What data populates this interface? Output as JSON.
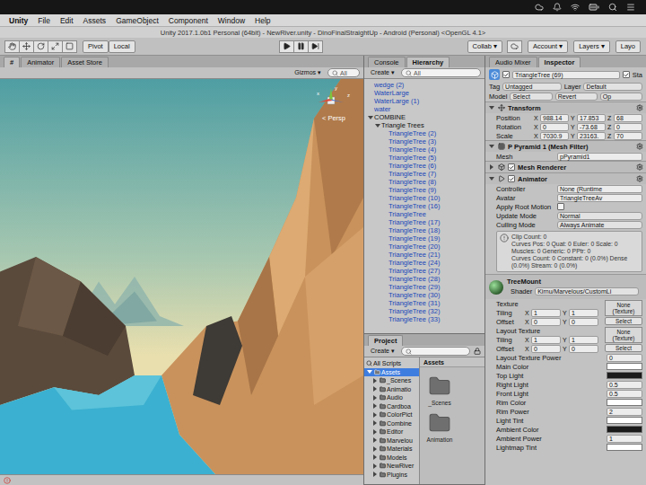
{
  "menu": [
    "Unity",
    "File",
    "Edit",
    "Assets",
    "GameObject",
    "Component",
    "Window",
    "Help"
  ],
  "title": "Unity 2017.1.0b1 Personal (64bit) - NewRiver.unity - DinoFinalStraightUp - Android (Personal) <OpenGL 4.1>",
  "toolbar": {
    "pivot": "Pivot",
    "local": "Local",
    "collab": "Collab ▾",
    "account": "Account ▾",
    "layers": "Layers ▾",
    "layout": "Layo"
  },
  "scene": {
    "tabs": [
      {
        "label": "#",
        "selected": true
      },
      {
        "label": "Animator",
        "selected": false
      },
      {
        "label": "Asset Store",
        "selected": false
      }
    ],
    "gizmos": "Gizmos ▾",
    "search": "All",
    "persp": "< Persp",
    "axes": [
      {
        "label": "y",
        "color": "#7ec53b"
      },
      {
        "label": "x",
        "color": "#e0483a"
      },
      {
        "label": "z",
        "color": "#3a6ee0"
      }
    ]
  },
  "hierarchy": {
    "tabs": [
      {
        "label": "Console",
        "selected": false
      },
      {
        "label": "Hierarchy",
        "selected": true
      }
    ],
    "create": "Create ▾",
    "search": "All",
    "items": [
      {
        "label": "wedge (2)",
        "kind": "prefab",
        "selected": false
      },
      {
        "label": "WaterLarge",
        "kind": "prefab",
        "selected": false
      },
      {
        "label": "WaterLarge (1)",
        "kind": "prefab",
        "selected": false
      },
      {
        "label": "water",
        "kind": "prefab",
        "selected": false
      },
      {
        "label": "COMBINE",
        "kind": "object",
        "selected": false,
        "expanded": true,
        "children": [
          {
            "label": "Triangle Trees",
            "kind": "object",
            "selected": false,
            "expanded": true,
            "children": [
              {
                "label": "TriangleTree (2)",
                "kind": "prefab",
                "selected": false
              },
              {
                "label": "TriangleTree (3)",
                "kind": "prefab",
                "selected": false
              },
              {
                "label": "TriangleTree (4)",
                "kind": "prefab",
                "selected": false
              },
              {
                "label": "TriangleTree (5)",
                "kind": "prefab",
                "selected": false
              },
              {
                "label": "TriangleTree (6)",
                "kind": "prefab",
                "selected": false
              },
              {
                "label": "TriangleTree (7)",
                "kind": "prefab",
                "selected": false
              },
              {
                "label": "TriangleTree (8)",
                "kind": "prefab",
                "selected": false
              },
              {
                "label": "TriangleTree (9)",
                "kind": "prefab",
                "selected": false
              },
              {
                "label": "TriangleTree (10)",
                "kind": "prefab",
                "selected": false
              },
              {
                "label": "TriangleTree (16)",
                "kind": "prefab",
                "selected": false
              },
              {
                "label": "TriangleTree",
                "kind": "prefab",
                "selected": false
              },
              {
                "label": "TriangleTree (17)",
                "kind": "prefab",
                "selected": false
              },
              {
                "label": "TriangleTree (18)",
                "kind": "prefab",
                "selected": false
              },
              {
                "label": "TriangleTree (19)",
                "kind": "prefab",
                "selected": false
              },
              {
                "label": "TriangleTree (20)",
                "kind": "prefab",
                "selected": false
              },
              {
                "label": "TriangleTree (21)",
                "kind": "prefab",
                "selected": false
              },
              {
                "label": "TriangleTree (24)",
                "kind": "prefab",
                "selected": false
              },
              {
                "label": "TriangleTree (27)",
                "kind": "prefab",
                "selected": false
              },
              {
                "label": "TriangleTree (28)",
                "kind": "prefab",
                "selected": false
              },
              {
                "label": "TriangleTree (29)",
                "kind": "prefab",
                "selected": false
              },
              {
                "label": "TriangleTree (30)",
                "kind": "prefab",
                "selected": false
              },
              {
                "label": "TriangleTree (31)",
                "kind": "prefab",
                "selected": false
              },
              {
                "label": "TriangleTree (32)",
                "kind": "prefab",
                "selected": false
              },
              {
                "label": "TriangleTree (33)",
                "kind": "prefab",
                "selected": false
              }
            ]
          }
        ]
      }
    ]
  },
  "project": {
    "tabs": [
      {
        "label": "Project",
        "selected": true
      }
    ],
    "create": "Create ▾",
    "favorites": [
      "All Scripts"
    ],
    "root": {
      "label": "Assets",
      "expanded": true,
      "selected": true,
      "children": [
        {
          "label": "_Scenes",
          "expanded": false,
          "selected": false
        },
        {
          "label": "Animatio",
          "expanded": false,
          "selected": false
        },
        {
          "label": "Audio",
          "expanded": false,
          "selected": false
        },
        {
          "label": "Cardboa",
          "expanded": false,
          "selected": false
        },
        {
          "label": "ColorPict",
          "expanded": false,
          "selected": false
        },
        {
          "label": "Combine",
          "expanded": false,
          "selected": false
        },
        {
          "label": "Editor",
          "expanded": false,
          "selected": false
        },
        {
          "label": "Marvelou",
          "expanded": false,
          "selected": false
        },
        {
          "label": "Materials",
          "expanded": false,
          "selected": false
        },
        {
          "label": "Models",
          "expanded": false,
          "selected": false
        },
        {
          "label": "NewRiver",
          "expanded": false,
          "selected": false
        },
        {
          "label": "Plugins",
          "expanded": false,
          "selected": false
        }
      ]
    },
    "breadcrumb": "Assets",
    "folders": [
      "_Scenes",
      "Animation"
    ]
  },
  "inspector": {
    "tabs": [
      {
        "label": "Audio Mixer",
        "selected": false
      },
      {
        "label": "Inspector",
        "selected": true
      }
    ],
    "object": {
      "name": "TriangleTree (69)",
      "active": true,
      "static_label": "Sta",
      "static": true
    },
    "tag": {
      "label": "Tag",
      "value": "Untagged"
    },
    "layer": {
      "label": "Layer",
      "value": "Default"
    },
    "model": {
      "label": "Model",
      "buttons": [
        "Select",
        "Revert",
        "Op"
      ]
    },
    "components": [
      {
        "title": "Transform",
        "expanded": true,
        "rows": [
          {
            "kind": "vector",
            "label": "Position",
            "values": [
              {
                "axis": "X",
                "value": "988.14"
              },
              {
                "axis": "Y",
                "value": "17.853"
              },
              {
                "axis": "Z",
                "value": "68"
              }
            ]
          },
          {
            "kind": "vector",
            "label": "Rotation",
            "values": [
              {
                "axis": "X",
                "value": "0"
              },
              {
                "axis": "Y",
                "value": "-73.68"
              },
              {
                "axis": "Z",
                "value": "0"
              }
            ]
          },
          {
            "kind": "vector",
            "label": "Scale",
            "values": [
              {
                "axis": "X",
                "value": "7030.9"
              },
              {
                "axis": "Y",
                "value": "23163."
              },
              {
                "axis": "Z",
                "value": "70"
              }
            ]
          }
        ]
      },
      {
        "title": "P Pyramid 1 (Mesh Filter)",
        "expanded": true,
        "rows": [
          {
            "kind": "field",
            "label": "Mesh",
            "value": "pPyramid1"
          }
        ]
      },
      {
        "title": "Mesh Renderer",
        "expanded": false,
        "enabled": true,
        "rows": []
      },
      {
        "title": "Animator",
        "expanded": true,
        "enabled": true,
        "rows": [
          {
            "kind": "field",
            "label": "Controller",
            "value": "None (Runtime"
          },
          {
            "kind": "field",
            "label": "Avatar",
            "value": "TriangleTreeAv"
          },
          {
            "kind": "toggle",
            "label": "Apply Root Motion",
            "checked": false
          },
          {
            "kind": "dropdown",
            "label": "Update Mode",
            "value": "Normal"
          },
          {
            "kind": "dropdown",
            "label": "Culling Mode",
            "value": "Always Animate"
          },
          {
            "kind": "info",
            "lines": [
              "Clip Count: 0",
              "Curves Pos: 0 Quat: 0 Euler: 0 Scale: 0",
              "Muscles: 0 Generic: 0 PPtr: 0",
              "Curves Count: 0 Constant: 0 (0.0%) Dense",
              "(0.0%) Stream: 0 (0.0%)"
            ]
          }
        ]
      }
    ],
    "material": {
      "name": "TreeMount",
      "shader_label": "Shader",
      "shader": "Kirnu/Marvelous/CustomLi",
      "props": [
        {
          "kind": "texture",
          "label": "Texture",
          "rows": [
            {
              "label": "Tiling",
              "values": [
                {
                  "axis": "X",
                  "value": "1"
                },
                {
                  "axis": "Y",
                  "value": "1"
                }
              ]
            },
            {
              "label": "Offset",
              "values": [
                {
                  "axis": "X",
                  "value": "0"
                },
                {
                  "axis": "Y",
                  "value": "0"
                }
              ]
            }
          ],
          "slot": "None (Texture)",
          "button": "Select"
        },
        {
          "kind": "texture",
          "label": "Layout Texture",
          "rows": [
            {
              "label": "Tiling",
              "values": [
                {
                  "axis": "X",
                  "value": "1"
                },
                {
                  "axis": "Y",
                  "value": "1"
                }
              ]
            },
            {
              "label": "Offset",
              "values": [
                {
                  "axis": "X",
                  "value": "0"
                },
                {
                  "axis": "Y",
                  "value": "0"
                }
              ]
            }
          ],
          "slot": "None (Texture)",
          "button": "Select"
        },
        {
          "kind": "number",
          "label": "Layout Texture Power",
          "value": "0"
        },
        {
          "kind": "color",
          "label": "Main Color",
          "color": "#ffffff"
        },
        {
          "kind": "color",
          "label": "Top Light",
          "color": "#1a1a1a"
        },
        {
          "kind": "number",
          "label": "Right Light",
          "value": "0.5"
        },
        {
          "kind": "number",
          "label": "Front Light",
          "value": "0.5"
        },
        {
          "kind": "color",
          "label": "Rim Color",
          "color": "#ffffff"
        },
        {
          "kind": "number",
          "label": "Rim Power",
          "value": "2"
        },
        {
          "kind": "color",
          "label": "Light Tint",
          "color": "#ffffff"
        },
        {
          "kind": "color",
          "label": "Ambient Color",
          "color": "#1a1a1a"
        },
        {
          "kind": "number",
          "label": "Ambient Power",
          "value": "1"
        },
        {
          "kind": "color",
          "label": "Lightmap Tint",
          "color": "#ffffff"
        }
      ]
    }
  }
}
